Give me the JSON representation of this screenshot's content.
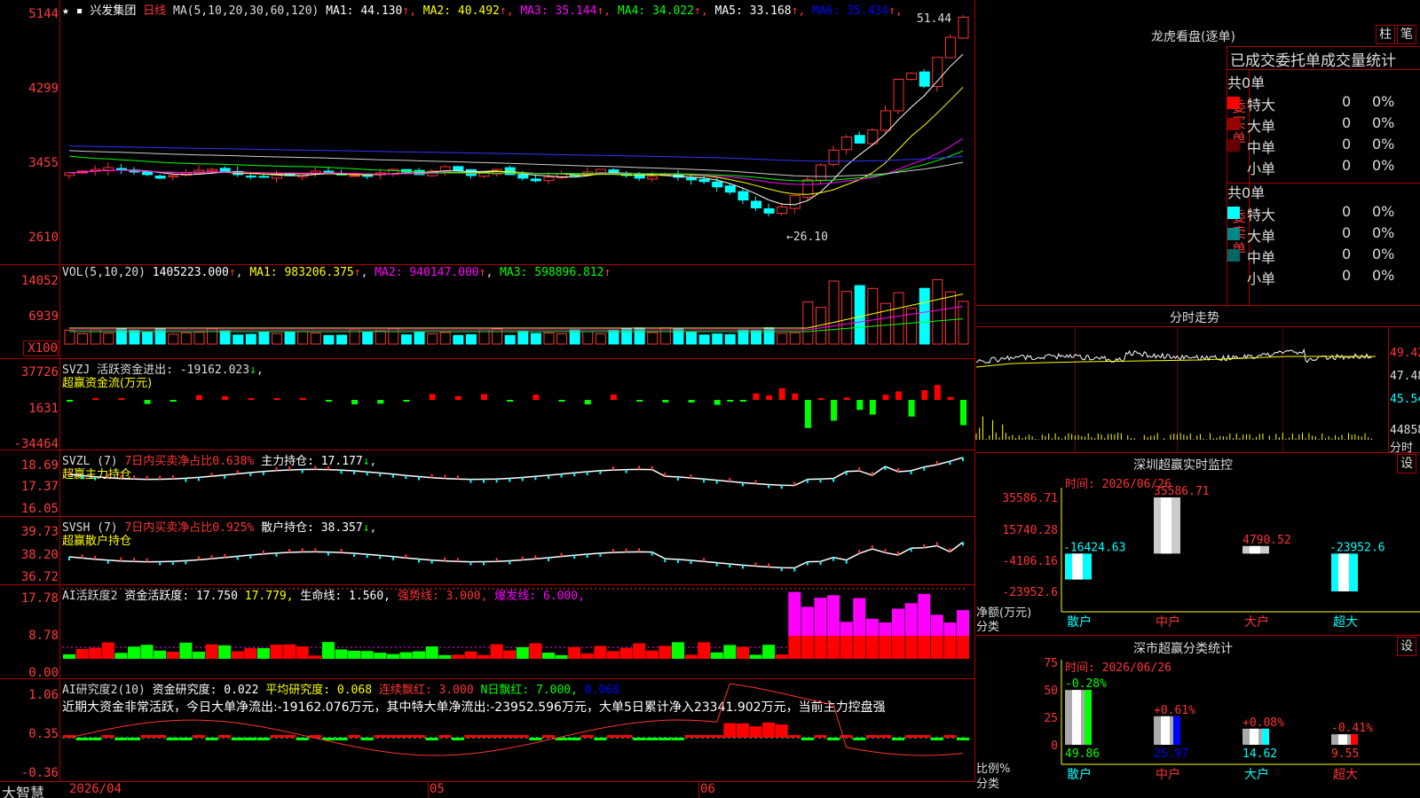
{
  "header": {
    "stock": "兴发集团",
    "period": "日线",
    "ma_params": "MA(5,10,20,30,60,120)",
    "ma": [
      {
        "label": "MA1:",
        "value": "44.130",
        "color": "#ffffff"
      },
      {
        "label": "MA2:",
        "value": "40.492",
        "color": "#ffff00"
      },
      {
        "label": "MA3:",
        "value": "35.144",
        "color": "#ff00ff"
      },
      {
        "label": "MA4:",
        "value": "34.022",
        "color": "#00ff00"
      },
      {
        "label": "MA5:",
        "value": "33.168",
        "color": "#ffffff"
      },
      {
        "label": "MA6:",
        "value": "35.434",
        "color": "#0000ff"
      }
    ]
  },
  "main_axis": [
    "5144",
    "4299",
    "3455",
    "2610"
  ],
  "price_marks": {
    "high": "51.44",
    "low": "26.10"
  },
  "vol": {
    "label": "VOL(5,10,20)",
    "value": "1405223.000",
    "ma1": "MA1: 983206.375",
    "ma2": "MA2: 940147.000",
    "ma3": "MA3: 598896.812",
    "axis": [
      "14052",
      "6939",
      "X100"
    ]
  },
  "svzj": {
    "label": "SVZJ",
    "desc": "活跃资金进出: -19162.023",
    "title": "超赢资金流(万元)",
    "axis": [
      "37726",
      "1631",
      "-34464"
    ]
  },
  "svzl": {
    "label": "SVZL (7)",
    "desc1": "7日内买卖净占比0.638%",
    "desc2": "主力持仓: 17.177",
    "title": "超赢主力持仓",
    "axis": [
      "18.69",
      "17.37",
      "16.05"
    ]
  },
  "svsh": {
    "label": "SVSH (7)",
    "desc1": "7日内买卖净占比0.925%",
    "desc2": "散户持仓: 38.357",
    "title": "超赢散户持仓",
    "axis": [
      "39.73",
      "38.20",
      "36.72"
    ]
  },
  "ai1": {
    "label": "AI活跃度2",
    "items": [
      {
        "text": "资金活跃度: 17.750",
        "color": "#ffffff"
      },
      {
        "text": "17.779,",
        "color": "#ffff00"
      },
      {
        "text": "生命线: 1.560,",
        "color": "#ffffff"
      },
      {
        "text": "强势线: 3.000,",
        "color": "#ff3333"
      },
      {
        "text": "爆发线: 6.000,",
        "color": "#ff00ff"
      }
    ],
    "axis": [
      "17.78",
      "8.78",
      "0.00"
    ]
  },
  "ai2": {
    "label": "AI研究度2(10)",
    "items": [
      {
        "text": "资金研究度: 0.022",
        "color": "#ffffff"
      },
      {
        "text": "平均研究度: 0.068",
        "color": "#ffff00"
      },
      {
        "text": "连续飘红: 3.000",
        "color": "#ff3333"
      },
      {
        "text": "N日飘红: 7.000,",
        "color": "#00ff00"
      },
      {
        "text": "0.068",
        "color": "#0000ff"
      }
    ],
    "note": "近期大资金非常活跃，今日大单净流出:-19162.076万元，其中特大单净流出:-23952.596万元，大单5日累计净入23341.902万元，当前主力控盘强",
    "axis": [
      "1.06",
      "0.35",
      "-0.36"
    ]
  },
  "bottom": {
    "brand": "大智慧",
    "date": "2026/04",
    "m5": "05",
    "m6": "06"
  },
  "dragon": {
    "title": "龙虎看盘(逐单)",
    "btn1": "柱",
    "btn2": "笔",
    "sub": "已成交委托单成交量统计",
    "buy": {
      "side": "委买单",
      "total": "共0单",
      "rows": [
        {
          "name": "特大",
          "count": "0",
          "pct": "0%",
          "color": "#ff0000"
        },
        {
          "name": "大单",
          "count": "0",
          "pct": "0%",
          "color": "#990000"
        },
        {
          "name": "中单",
          "count": "0",
          "pct": "0%",
          "color": "#660000"
        },
        {
          "name": "小单",
          "count": "0",
          "pct": "0%",
          "color": "#000000"
        }
      ]
    },
    "sell": {
      "side": "委卖单",
      "total": "共0单",
      "rows": [
        {
          "name": "特大",
          "count": "0",
          "pct": "0%",
          "color": "#00ffff"
        },
        {
          "name": "大单",
          "count": "0",
          "pct": "0%",
          "color": "#008888"
        },
        {
          "name": "中单",
          "count": "0",
          "pct": "0%",
          "color": "#006666"
        },
        {
          "name": "小单",
          "count": "0",
          "pct": "0%",
          "color": "#000000"
        }
      ]
    }
  },
  "intraday": {
    "title": "分时走势",
    "axis": [
      "49.42",
      "47.48",
      "45.54",
      "44858",
      "分时"
    ]
  },
  "monitor": {
    "title": "深圳超赢实时监控",
    "btn": "设",
    "time": "时间: 2026/06/26",
    "axis": [
      "35586.71",
      "15740.28",
      "-4106.16",
      "-23952.6"
    ],
    "ylabel1": "净额(万元)",
    "ylabel2": "分类",
    "bars": [
      {
        "cat": "散户",
        "value": "-16424.63"
      },
      {
        "cat": "中户",
        "value": "35586.71"
      },
      {
        "cat": "大户",
        "value": "4790.52"
      },
      {
        "cat": "超大",
        "value": "-23952.6"
      }
    ]
  },
  "classify": {
    "title": "深市超赢分类统计",
    "btn": "设",
    "time": "时间: 2026/06/26",
    "axis": [
      "75",
      "50",
      "25",
      "0"
    ],
    "ylabel1": "比例%",
    "ylabel2": "分类",
    "bars": [
      {
        "cat": "散户",
        "top": "-0.28%",
        "bottom": "49.86"
      },
      {
        "cat": "中户",
        "top": "+0.61%",
        "bottom": "25.97"
      },
      {
        "cat": "大户",
        "top": "+0.08%",
        "bottom": "14.62"
      },
      {
        "cat": "超大",
        "top": "-0.41%",
        "bottom": "9.55"
      }
    ]
  },
  "chart_data": [
    {
      "type": "candlestick",
      "title": "兴发集团 日线",
      "ylim": [
        26.1,
        51.44
      ],
      "ohlc_note": "daily bars Apr–Jun 2026",
      "closes": [
        33.2,
        33.4,
        33.6,
        33.8,
        33.5,
        33.3,
        33.0,
        32.6,
        32.9,
        33.2,
        33.5,
        33.6,
        33.3,
        33.0,
        32.8,
        32.7,
        33.0,
        32.9,
        33.1,
        33.4,
        33.2,
        33.0,
        32.9,
        32.8,
        33.2,
        33.6,
        33.3,
        33.0,
        33.4,
        33.9,
        33.5,
        32.9,
        33.2,
        33.6,
        33.0,
        32.6,
        32.3,
        32.7,
        33.1,
        32.9,
        33.3,
        33.6,
        33.2,
        32.9,
        32.6,
        32.8,
        33.0,
        32.7,
        32.4,
        32.2,
        31.6,
        31.0,
        30.1,
        29.2,
        28.6,
        29.3,
        30.6,
        32.4,
        34.1,
        35.8,
        37.3,
        36.6,
        38.1,
        40.3,
        43.9,
        44.6,
        43.1,
        46.4,
        48.7,
        51.0
      ]
    },
    {
      "type": "bar",
      "title": "深圳超赢实时监控",
      "categories": [
        "散户",
        "中户",
        "大户",
        "超大"
      ],
      "values": [
        -16424.63,
        35586.71,
        4790.52,
        -23952.6
      ],
      "ylabel": "净额(万元)"
    },
    {
      "type": "bar",
      "title": "深市超赢分类统计",
      "categories": [
        "散户",
        "中户",
        "大户",
        "超大"
      ],
      "values": [
        49.86,
        25.97,
        14.62,
        9.55
      ],
      "changes": [
        "-0.28%",
        "+0.61%",
        "+0.08%",
        "-0.41%"
      ],
      "ylabel": "比例%",
      "ylim": [
        0,
        75
      ]
    }
  ]
}
